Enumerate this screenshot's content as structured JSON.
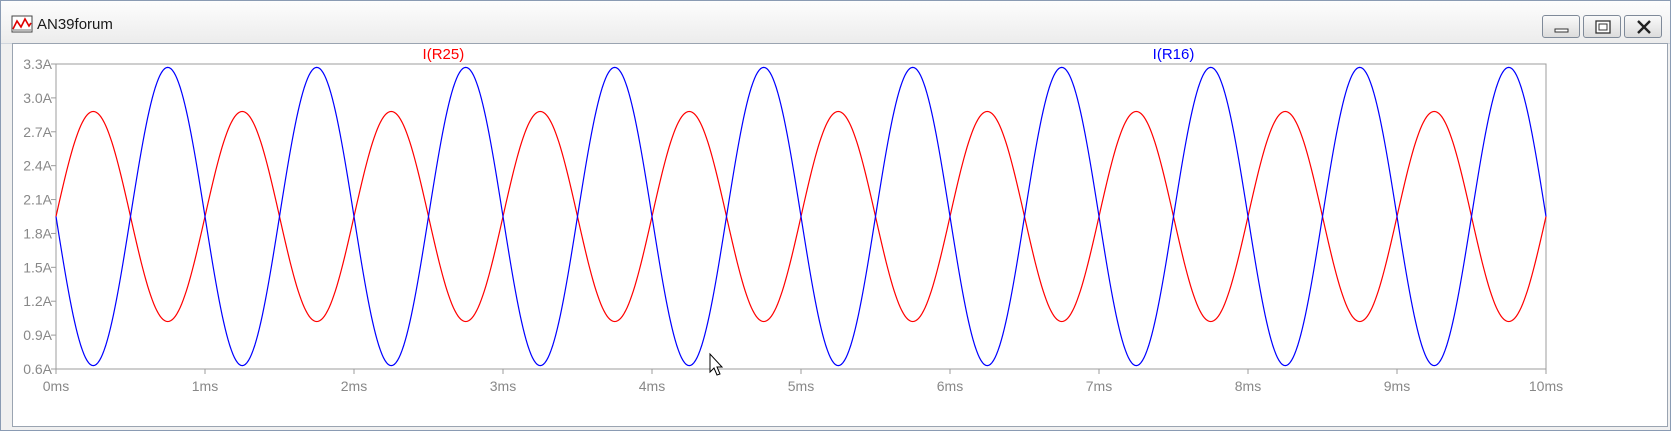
{
  "window": {
    "title": "AN39forum",
    "icon": "waveform-chart-icon"
  },
  "buttons": {
    "minimize": "minimize-icon",
    "maximize": "maximize-icon",
    "close": "close-icon"
  },
  "colors": {
    "series_r25": "#ff0000",
    "series_r16": "#0000ff",
    "grid": "#c8c8c8",
    "tick_text": "#888888"
  },
  "chart_data": {
    "type": "line",
    "grid": false,
    "legend": "top",
    "xlim": [
      0,
      10
    ],
    "ylim": [
      0.6,
      3.3
    ],
    "x_ticks": [
      "0ms",
      "1ms",
      "2ms",
      "3ms",
      "4ms",
      "5ms",
      "6ms",
      "7ms",
      "8ms",
      "9ms",
      "10ms"
    ],
    "x_tick_values": [
      0,
      1,
      2,
      3,
      4,
      5,
      6,
      7,
      8,
      9,
      10
    ],
    "y_ticks": [
      "0.6A",
      "0.9A",
      "1.2A",
      "1.5A",
      "1.8A",
      "2.1A",
      "2.4A",
      "2.7A",
      "3.0A",
      "3.3A"
    ],
    "y_tick_values": [
      0.6,
      0.9,
      1.2,
      1.5,
      1.8,
      2.1,
      2.4,
      2.7,
      3.0,
      3.3
    ],
    "series": [
      {
        "name": "I(R25)",
        "color": "#ff0000",
        "x": [
          0,
          0.25,
          0.5,
          0.75,
          1,
          1.25,
          1.5,
          1.75,
          2,
          2.25,
          2.5,
          2.75,
          3,
          3.25,
          3.5,
          3.75,
          4,
          4.25,
          4.5,
          4.75,
          5,
          5.25,
          5.5,
          5.75,
          6,
          6.25,
          6.5,
          6.75,
          7,
          7.25,
          7.5,
          7.75,
          8,
          8.25,
          8.5,
          8.75,
          9,
          9.25,
          9.5,
          9.75,
          10
        ],
        "y": [
          1.95,
          2.88,
          1.95,
          1.02,
          1.95,
          2.88,
          1.95,
          1.02,
          1.95,
          2.88,
          1.95,
          1.02,
          1.95,
          2.88,
          1.95,
          1.02,
          1.95,
          2.88,
          1.95,
          1.02,
          1.95,
          2.88,
          1.95,
          1.02,
          1.95,
          2.88,
          1.95,
          1.02,
          1.95,
          2.88,
          1.95,
          1.02,
          1.95,
          2.88,
          1.95,
          1.02,
          1.95,
          2.88,
          1.95,
          1.02,
          1.95
        ]
      },
      {
        "name": "I(R16)",
        "color": "#0000ff",
        "x": [
          0,
          0.25,
          0.5,
          0.75,
          1,
          1.25,
          1.5,
          1.75,
          2,
          2.25,
          2.5,
          2.75,
          3,
          3.25,
          3.5,
          3.75,
          4,
          4.25,
          4.5,
          4.75,
          5,
          5.25,
          5.5,
          5.75,
          6,
          6.25,
          6.5,
          6.75,
          7,
          7.25,
          7.5,
          7.75,
          8,
          8.25,
          8.5,
          8.75,
          9,
          9.25,
          9.5,
          9.75,
          10
        ],
        "y": [
          1.95,
          0.63,
          1.95,
          3.27,
          1.95,
          0.63,
          1.95,
          3.27,
          1.95,
          0.63,
          1.95,
          3.27,
          1.95,
          0.63,
          1.95,
          3.27,
          1.95,
          0.63,
          1.95,
          3.27,
          1.95,
          0.63,
          1.95,
          3.27,
          1.95,
          0.63,
          1.95,
          3.27,
          1.95,
          0.63,
          1.95,
          3.27,
          1.95,
          0.63,
          1.95,
          3.27,
          1.95,
          0.63,
          1.95,
          3.27,
          1.95
        ]
      }
    ]
  }
}
